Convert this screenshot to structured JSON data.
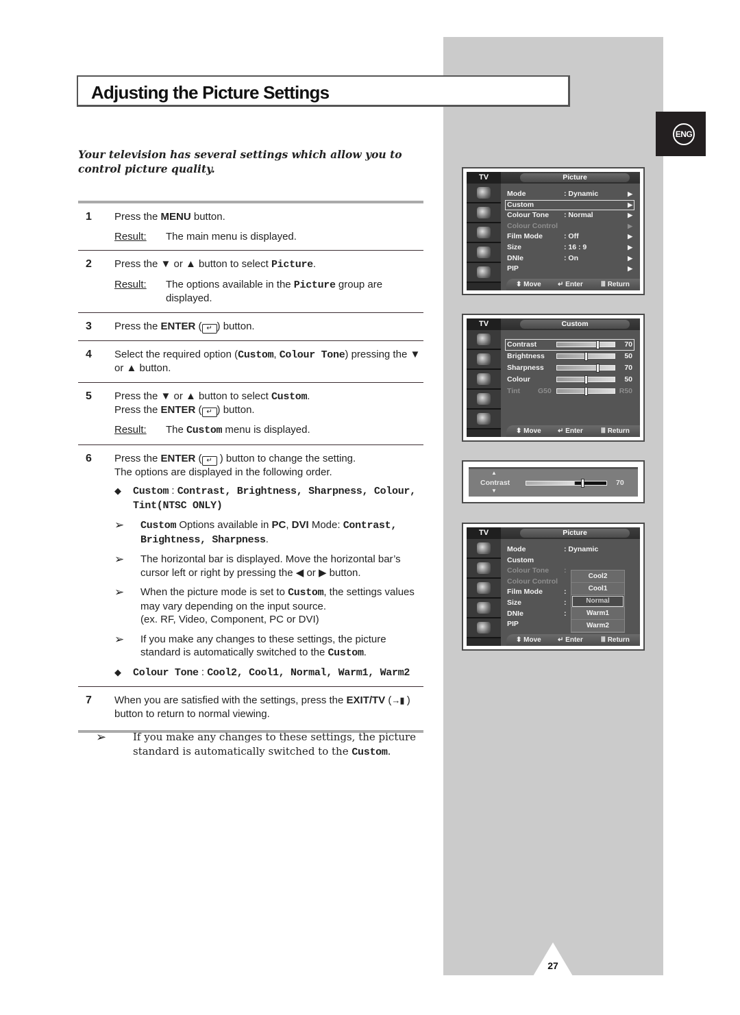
{
  "page": {
    "title": "Adjusting the Picture Settings",
    "intro": "Your television has several settings which allow you to control picture quality.",
    "language_badge": "ENG",
    "page_number": "27",
    "accent_colors": {
      "side_panel": "#cbcbcb",
      "badge": "#231f20",
      "osd_background": "#555555"
    }
  },
  "steps": [
    {
      "num": "1",
      "text_a": "Press the ",
      "key": "MENU",
      "text_b": " button.",
      "result_label": "Result:",
      "result": "The main menu is displayed."
    },
    {
      "num": "2",
      "text_a": "Press the ▼ or ▲ button to select ",
      "code": "Picture",
      "text_b": ".",
      "result_label": "Result:",
      "result_a": "The options available in the ",
      "result_code": "Picture",
      "result_b": " group are displayed."
    },
    {
      "num": "3",
      "text_a": "Press the ",
      "key": "ENTER",
      "text_b": " (",
      "text_c": ") button."
    },
    {
      "num": "4",
      "text_a": "Select the required option (",
      "code1": "Custom",
      "sep": ", ",
      "code2": "Colour Tone",
      "text_b": ") pressing the ▼ or ▲ button."
    },
    {
      "num": "5",
      "text_a": "Press the ▼ or ▲ button to select ",
      "code": "Custom",
      "text_b": ".",
      "line2_a": "Press the ",
      "key": "ENTER",
      "line2_b": " (",
      "line2_c": ") button.",
      "result_label": "Result:",
      "result_a": "The ",
      "result_code": "Custom",
      "result_b": " menu is displayed."
    },
    {
      "num": "6",
      "text_a": "Press the ",
      "key": "ENTER",
      "text_b": " (",
      "text_c": " ) button to change the setting.",
      "line2": "The options are displayed in the following order.",
      "bullet1": {
        "label": "Custom",
        "colon": " : ",
        "items": "Contrast, Brightness, Sharpness, Colour, Tint(NTSC ONLY)"
      },
      "notes": [
        {
          "code": "Custom",
          "text_a": " Options available in ",
          "k1": "PC",
          "sep": ", ",
          "k2": "DVI",
          "text_b": " Mode: ",
          "code2": "Contrast, Brightness, Sharpness",
          "text_c": "."
        },
        {
          "text": "The horizontal bar is displayed. Move the horizontal bar’s cursor left or right by pressing the ◀ or ▶ button."
        },
        {
          "text_a": "When the picture mode is set to ",
          "code": "Custom",
          "text_b": ", the settings values may vary depending on the input source.",
          "line2": "(ex. RF, Video, Component, PC or DVI)"
        },
        {
          "text_a": "If you make any changes to these settings, the picture standard is automatically switched to the ",
          "code": "Custom",
          "text_b": "."
        }
      ],
      "bullet2": {
        "label": "Colour Tone",
        "colon": " : ",
        "items": "Cool2, Cool1, Normal, Warm1, Warm2"
      }
    },
    {
      "num": "7",
      "text_a": "When you are satisfied with the settings, press the ",
      "key": "EXIT/TV",
      "text_b": " (",
      "icon": "→▮",
      "text_c": " ) button to return to normal viewing."
    }
  ],
  "footer_note": {
    "text_a": "If you make any changes to these settings, the picture standard is automatically switched to the ",
    "code": "Custom",
    "text_b": "."
  },
  "osd": {
    "tv_label": "TV",
    "footer": {
      "move": "Move",
      "enter": "Enter",
      "return": "Return"
    },
    "picture_menu": {
      "title": "Picture",
      "rows": [
        {
          "label": "Mode",
          "value": ": Dynamic",
          "arrow": "▶"
        },
        {
          "label": "Custom",
          "value": "",
          "arrow": "▶",
          "selected": true
        },
        {
          "label": "Colour Tone",
          "value": ": Normal",
          "arrow": "▶"
        },
        {
          "label": "Colour Control",
          "value": "",
          "arrow": "▶",
          "disabled": true
        },
        {
          "label": "Film Mode",
          "value": ": Off",
          "arrow": "▶"
        },
        {
          "label": "Size",
          "value": ": 16 : 9",
          "arrow": "▶"
        },
        {
          "label": "DNIe",
          "value": ": On",
          "arrow": "▶"
        },
        {
          "label": "PIP",
          "value": "",
          "arrow": "▶"
        }
      ]
    },
    "custom_menu": {
      "title": "Custom",
      "sliders": [
        {
          "label": "Contrast",
          "value": "70",
          "level": 70,
          "selected": true
        },
        {
          "label": "Brightness",
          "value": "50",
          "level": 50
        },
        {
          "label": "Sharpness",
          "value": "70",
          "level": 70
        },
        {
          "label": "Colour",
          "value": "50",
          "level": 50
        },
        {
          "label": "Tint",
          "left": "G50",
          "value": "R50",
          "level": 50,
          "disabled": true
        }
      ]
    },
    "contrast_bar": {
      "label": "Contrast",
      "value": "70",
      "level": 70
    },
    "colour_tone_menu": {
      "title": "Picture",
      "rows": [
        {
          "label": "Mode",
          "value": ": Dynamic"
        },
        {
          "label": "Custom",
          "value": ""
        },
        {
          "label": "Colour Tone",
          "value": ":",
          "disabled": true
        },
        {
          "label": "Colour Control",
          "value": "",
          "disabled": true
        },
        {
          "label": "Film Mode",
          "value": ":"
        },
        {
          "label": "Size",
          "value": ":"
        },
        {
          "label": "DNIe",
          "value": ":"
        },
        {
          "label": "PIP",
          "value": ""
        }
      ],
      "options": [
        "Cool2",
        "Cool1",
        "Normal",
        "Warm1",
        "Warm2"
      ],
      "selected_option": "Normal"
    }
  }
}
